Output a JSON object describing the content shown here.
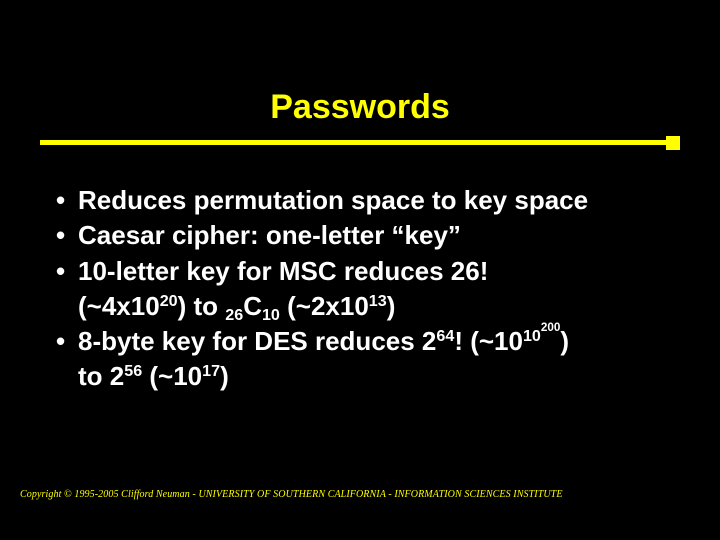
{
  "title": "Passwords",
  "bullets": {
    "b1": "Reduces permutation space to key space",
    "b2": "Caesar cipher: one-letter “key”",
    "b3a": "10-letter key for MSC reduces 26!",
    "b3b_p1": "(~4x10",
    "b3b_e1": "20",
    "b3b_p2": ") to ",
    "b3b_s1": "26",
    "b3b_p3": "C",
    "b3b_s2": "10",
    "b3b_p4": " (~2x10",
    "b3b_e2": "13",
    "b3b_p5": ")",
    "b4a_p1": "8-byte key for DES reduces 2",
    "b4a_e1": "64",
    "b4a_p2": "! (~10",
    "b4a_e2": "10",
    "b4a_ee": "200",
    "b4a_p3": ")",
    "b4b_p1": "to 2",
    "b4b_e1": "56",
    "b4b_p2": " (~10",
    "b4b_e2": "17",
    "b4b_p3": ")"
  },
  "footer": "Copyright © 1995-2005 Clifford Neuman - UNIVERSITY OF SOUTHERN CALIFORNIA - INFORMATION SCIENCES INSTITUTE"
}
